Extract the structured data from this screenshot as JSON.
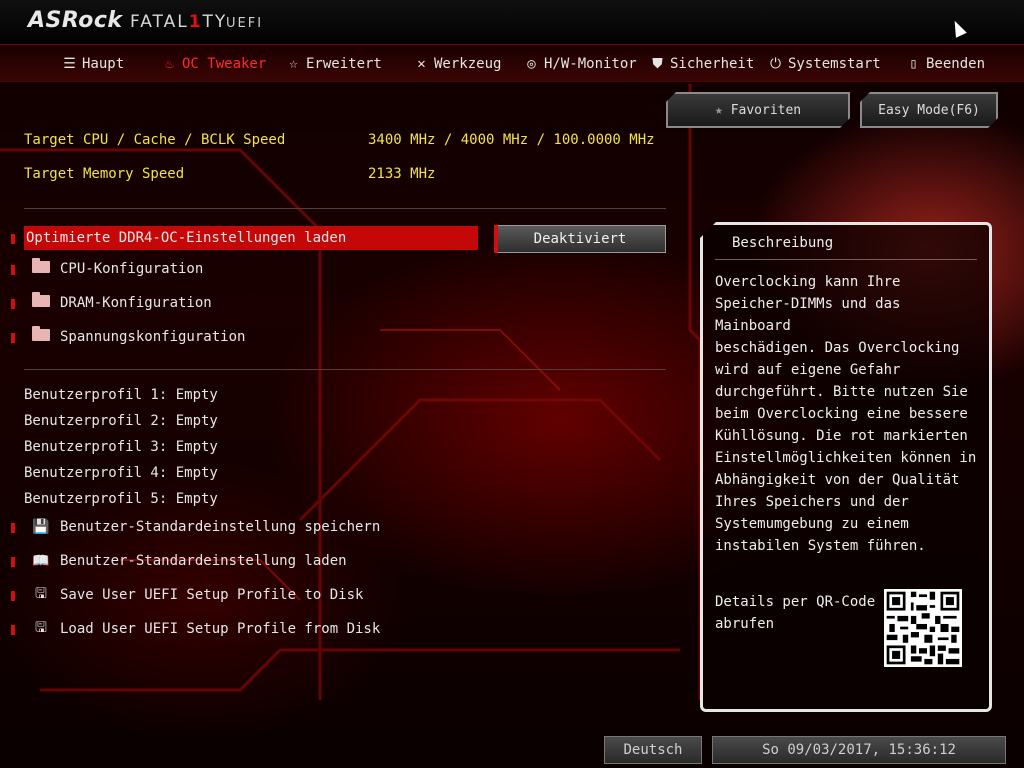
{
  "header": {
    "brand": "ASRock",
    "product": "FATAL",
    "product_one": "1",
    "product_tail": "TY",
    "uefi": "UEFI"
  },
  "nav": [
    {
      "label": "Haupt",
      "icon": "list-icon"
    },
    {
      "label": "OC Tweaker",
      "icon": "flame-icon",
      "active": true
    },
    {
      "label": "Erweitert",
      "icon": "star-icon"
    },
    {
      "label": "Werkzeug",
      "icon": "tools-icon"
    },
    {
      "label": "H/W-Monitor",
      "icon": "monitor-icon"
    },
    {
      "label": "Sicherheit",
      "icon": "shield-icon"
    },
    {
      "label": "Systemstart",
      "icon": "power-icon"
    },
    {
      "label": "Beenden",
      "icon": "exit-icon"
    }
  ],
  "buttons": {
    "favorites": "Favoriten",
    "easy_mode": "Easy Mode(F6)"
  },
  "targets": [
    {
      "label": "Target CPU / Cache / BCLK Speed",
      "value": "3400 MHz / 4000 MHz / 100.0000 MHz"
    },
    {
      "label": "Target Memory Speed",
      "value": "2133 MHz"
    }
  ],
  "settings": {
    "ddr4_label": "Optimierte DDR4-OC-Einstellungen laden",
    "ddr4_value": "Deaktiviert",
    "folders": [
      "CPU-Konfiguration",
      "DRAM-Konfiguration",
      "Spannungskonfiguration"
    ]
  },
  "profiles": [
    "Benutzerprofil 1: Empty",
    "Benutzerprofil 2: Empty",
    "Benutzerprofil 3: Empty",
    "Benutzerprofil 4: Empty",
    "Benutzerprofil 5: Empty"
  ],
  "actions": [
    {
      "label": "Benutzer-Standardeinstellung speichern",
      "icon": "floppy-icon"
    },
    {
      "label": "Benutzer-Standardeinstellung laden",
      "icon": "book-icon"
    },
    {
      "label": "Save User UEFI Setup Profile to Disk",
      "icon": "disk-save-icon"
    },
    {
      "label": "Load User UEFI Setup Profile from Disk",
      "icon": "disk-load-icon"
    }
  ],
  "description": {
    "title": "Beschreibung",
    "text": "Overclocking kann Ihre\nSpeicher-DIMMs und das Mainboard\nbeschädigen. Das Overclocking\nwird auf eigene Gefahr\ndurchgeführt. Bitte nutzen Sie\nbeim Overclocking eine bessere\nKühllösung. Die rot markierten\nEinstellmöglichkeiten können in\nAbhängigkeit von der Qualität\nIhres Speichers und der\nSystemumgebung zu einem\ninstabilen System führen.",
    "qr_label": "Details per QR-Code\nabrufen"
  },
  "footer": {
    "language": "Deutsch",
    "datetime": "So 09/03/2017, 15:36:12"
  },
  "colors": {
    "accent": "#c40808",
    "target_text": "#f2e24a",
    "active_tab": "#ff2a2a"
  }
}
